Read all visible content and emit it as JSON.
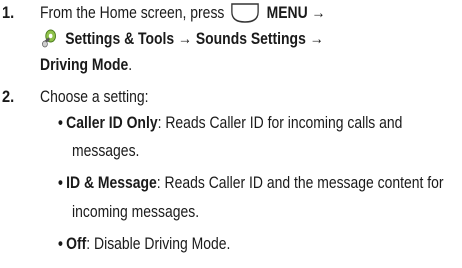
{
  "steps": [
    {
      "number": "1.",
      "line1_prefix": "From the Home screen, press",
      "menu_label": "MENU",
      "arrow": "→",
      "settings_tools": "Settings & Tools",
      "sounds_settings": "Sounds Settings",
      "driving_mode": "Driving Mode",
      "period": "."
    },
    {
      "number": "2.",
      "text": "Choose a setting:"
    }
  ],
  "options": [
    {
      "name": "Caller ID Only",
      "desc_line1": ": Reads Caller ID for incoming calls and",
      "desc_line2": "messages."
    },
    {
      "name": "ID & Message",
      "desc_line1": ": Reads Caller ID and the message content for",
      "desc_line2": "incoming messages."
    },
    {
      "name": "Off",
      "desc_line1": ": Disable Driving Mode."
    }
  ],
  "bullet": "•",
  "icons": {
    "menu_key": "menu-key-icon",
    "settings": "settings-tools-icon"
  }
}
